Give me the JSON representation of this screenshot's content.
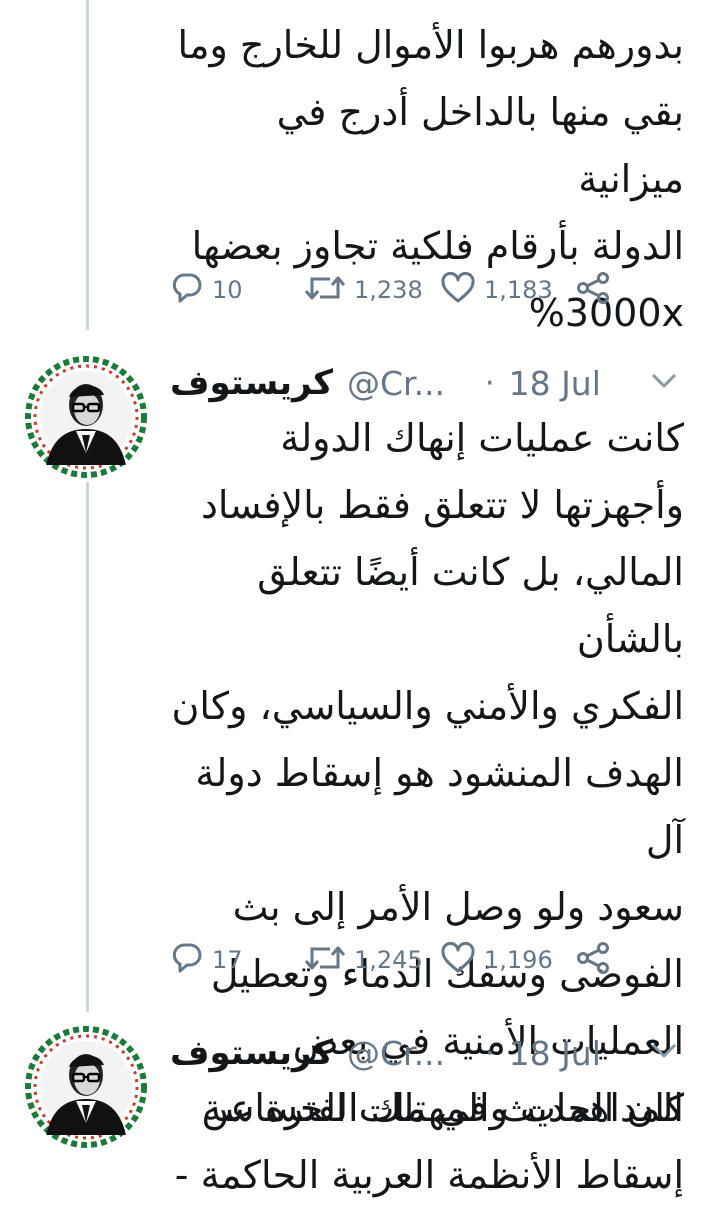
{
  "tweets": [
    {
      "text": "بدورهم هربوا الأموال للخارج وما\nبقي منها بالداخل أدرج في ميزانية\nالدولة بأرقام فلكية تجاوز بعضها\n%3000x",
      "replies": "10",
      "retweets": "1,238",
      "likes": "1,183"
    },
    {
      "name": "كريستوف",
      "handle": "@Cr...",
      "separator": "·",
      "date": "18 Jul",
      "text": "كانت عمليات إنهاك الدولة\nوأجهزتها لا تتعلق فقط بالإفساد\nالمالي، بل كانت أيضًا تتعلق بالشأن\nالفكري والأمني والسياسي، وكان\nالهدف المنشود هو إسقاط دولة آل\nسعود ولو وصل الأمر إلى بث\nالفوضى وسفك الدماء وتعطيل\nالعمليات الأمنية في بعض\nالمداهمات والمهمات الحساسة",
      "replies": "17",
      "retweets": "1,245",
      "likes": "1,196"
    },
    {
      "name": "كريستوف",
      "handle": "@Cr...",
      "separator": "·",
      "date": "18 Jul",
      "text": "كان الحديث في تلك الفترة عن\nإسقاط الأنظمة العربية الحاكمة -"
    }
  ],
  "icons": {
    "reply": "reply-icon",
    "retweet": "retweet-icon",
    "like": "heart-icon",
    "share": "share-icon",
    "menu": "chevron-down-icon"
  },
  "colors": {
    "text": "#14171a",
    "muted": "#657786",
    "thread_line": "#ccd6dd"
  }
}
